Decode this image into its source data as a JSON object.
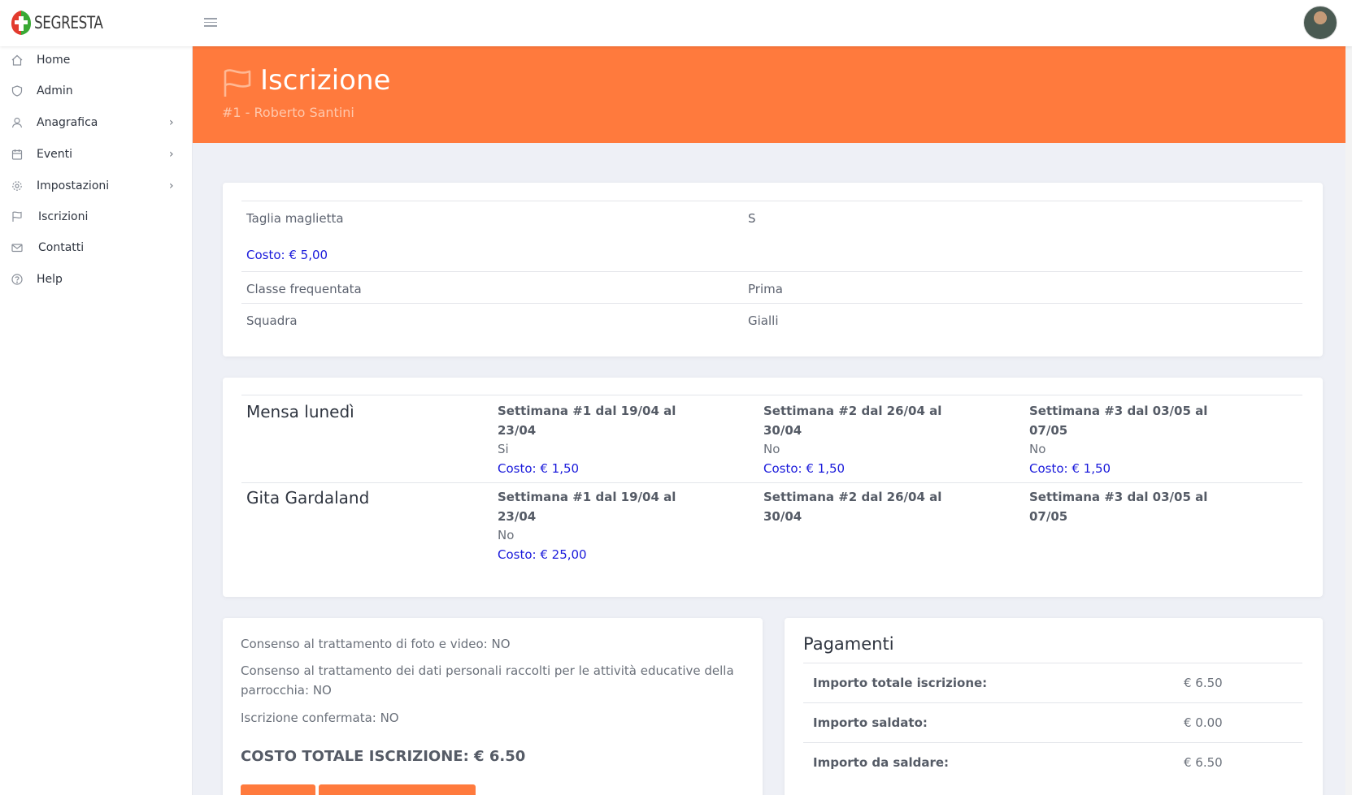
{
  "app": {
    "logo_text": "SEGRESTA",
    "brand_color": "#ff7a3d",
    "link_color": "#1a1adb"
  },
  "sidebar": {
    "items": [
      {
        "label": "Home",
        "icon": "home-icon",
        "has_children": false
      },
      {
        "label": "Admin",
        "icon": "shield-icon",
        "has_children": false
      },
      {
        "label": "Anagrafica",
        "icon": "user-icon",
        "has_children": true
      },
      {
        "label": "Eventi",
        "icon": "calendar-icon",
        "has_children": true
      },
      {
        "label": "Impostazioni",
        "icon": "gear-icon",
        "has_children": true
      },
      {
        "label": "Iscrizioni",
        "icon": "flag-icon",
        "has_children": false
      },
      {
        "label": "Contatti",
        "icon": "mail-icon",
        "has_children": false
      },
      {
        "label": "Help",
        "icon": "help-icon",
        "has_children": false
      }
    ],
    "chevron": "›"
  },
  "header": {
    "title": "Iscrizione",
    "subtitle": "#1 - Roberto Santini",
    "icon": "flag-icon"
  },
  "fields": [
    {
      "label": "Taglia maglietta",
      "value": "S",
      "cost": "Costo: € 5,00"
    },
    {
      "label": "Classe frequentata",
      "value": "Prima"
    },
    {
      "label": "Squadra",
      "value": "Gialli"
    }
  ],
  "services": [
    {
      "name": "Mensa lunedì",
      "weeks": [
        {
          "title": "Settimana #1 dal 19/04 al 23/04",
          "value": "Si",
          "cost": "Costo: € 1,50"
        },
        {
          "title": "Settimana #2 dal 26/04 al 30/04",
          "value": "No",
          "cost": "Costo: € 1,50"
        },
        {
          "title": "Settimana #3 dal 03/05 al 07/05",
          "value": "No",
          "cost": "Costo: € 1,50"
        }
      ]
    },
    {
      "name": "Gita Gardaland",
      "weeks": [
        {
          "title": "Settimana #1 dal 19/04 al 23/04",
          "value": "No",
          "cost": "Costo: € 25,00"
        },
        {
          "title": "Settimana #2 dal 26/04 al 30/04"
        },
        {
          "title": "Settimana #3 dal 03/05 al 07/05"
        }
      ]
    }
  ],
  "consents": {
    "photo": "Consenso al trattamento di foto e video: NO",
    "personal": "Consenso al trattamento dei dati personali raccolti per le attività educative della parrocchia: NO",
    "confirmed": "Iscrizione confermata: NO",
    "total": "COSTO TOTALE ISCRIZIONE: € 6.50"
  },
  "payments": {
    "title": "Pagamenti",
    "rows": [
      {
        "label": "Importo totale iscrizione:",
        "value": "€ 6.50"
      },
      {
        "label": "Importo saldato:",
        "value": "€ 0.00"
      },
      {
        "label": "Importo da saldare:",
        "value": "€ 6.50"
      }
    ]
  }
}
